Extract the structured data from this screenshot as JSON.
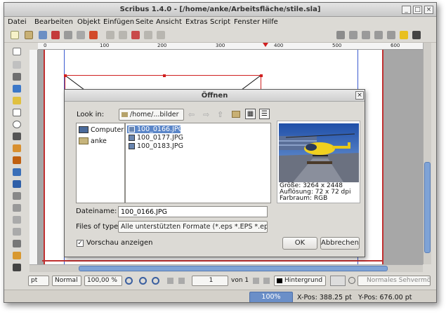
{
  "window": {
    "title": "Scribus 1.4.0 - [/home/anke/Arbeitsfläche/stile.sla]",
    "controls": [
      "_",
      "□",
      "×"
    ]
  },
  "menu": [
    "Datei",
    "Bearbeiten",
    "Objekt",
    "Einfügen",
    "Seite",
    "Ansicht",
    "Extras",
    "Script",
    "Fenster",
    "Hilfe"
  ],
  "ruler": {
    "labels": [
      "0",
      "100",
      "200",
      "300",
      "400",
      "500",
      "600"
    ]
  },
  "bottom_bar": {
    "unit": "pt",
    "mode": "Normal",
    "zoom": "100,00 %",
    "page": "1",
    "page_of": "von 1",
    "layer": "Hintergrund",
    "view": "Normales Sehvermögen"
  },
  "status": {
    "zoom_pill": "100%",
    "x_pos": "X-Pos: 388.25 pt",
    "y_pos": "Y-Pos: 676.00 pt"
  },
  "dialog": {
    "title": "Öffnen",
    "look_in_label": "Look in:",
    "look_in_value": "/home/...bilder",
    "places": [
      "Computer",
      "anke"
    ],
    "files": [
      "100_0166.JPG",
      "100_0177.JPG",
      "100_0183.JPG"
    ],
    "selected_file": "100_0166.JPG",
    "preview_info": [
      "Größe: 3264 x 2448",
      "Auflösung: 72 x 72 dpi",
      "Farbraum: RGB"
    ],
    "filename_label": "Dateiname:",
    "filename_value": "100_0166.JPG",
    "filetype_label": "Files of type:",
    "filetype_value": "Alle unterstützten Formate (*.eps *.EPS *.eps",
    "preview_checkbox_label": "Vorschau anzeigen",
    "preview_checked": true,
    "ok_label": "OK",
    "cancel_label": "Abbrechen"
  }
}
